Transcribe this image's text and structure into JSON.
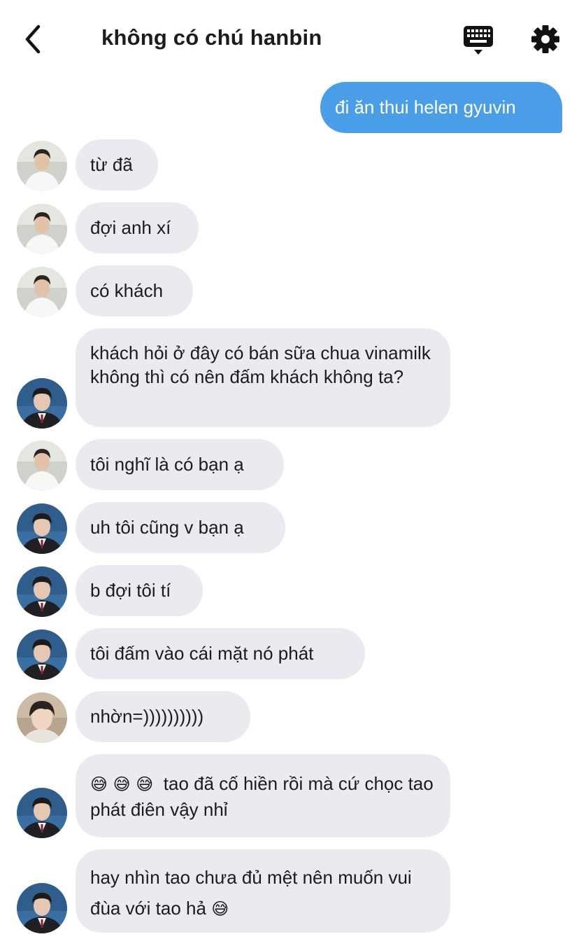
{
  "header": {
    "title": "không có chú hanbin",
    "back_icon": "chevron-left-icon",
    "keyboard_icon": "keyboard-icon",
    "settings_icon": "gear-icon"
  },
  "colors": {
    "sent_bubble": "#4a9ee8",
    "received_bubble": "#e9ebf0",
    "text": "#1c1c1e"
  },
  "messages": [
    {
      "sender": "me",
      "text": "đi ăn thui helen gyuvin"
    },
    {
      "sender": "white-shirt-boy",
      "text": "từ đã"
    },
    {
      "sender": "white-shirt-boy",
      "text": "đợi anh xí"
    },
    {
      "sender": "white-shirt-boy",
      "text": "có khách"
    },
    {
      "sender": "suit-boy",
      "text": "khách hỏi ở đây có bán sữa chua vinamilk không thì có nên đấm khách không ta?"
    },
    {
      "sender": "white-shirt-boy",
      "text": "tôi nghĩ là có bạn ạ"
    },
    {
      "sender": "suit-boy",
      "text": "uh tôi cũng v bạn ạ"
    },
    {
      "sender": "suit-boy",
      "text": "b đợi tôi tí"
    },
    {
      "sender": "suit-boy",
      "text": "tôi đấm vào cái mặt nó phát"
    },
    {
      "sender": "selfie-boy",
      "text": "nhờn=))))))))))"
    },
    {
      "sender": "suit-boy",
      "emoji": "😅 😅 😅",
      "text": "tao đã cố hiền rồi mà cứ chọc tao phát điên vậy nhỉ"
    },
    {
      "sender": "suit-boy",
      "text": "hay nhìn tao chưa đủ mệt nên muốn vui đùa với tao hả",
      "emoji": "😅"
    }
  ]
}
